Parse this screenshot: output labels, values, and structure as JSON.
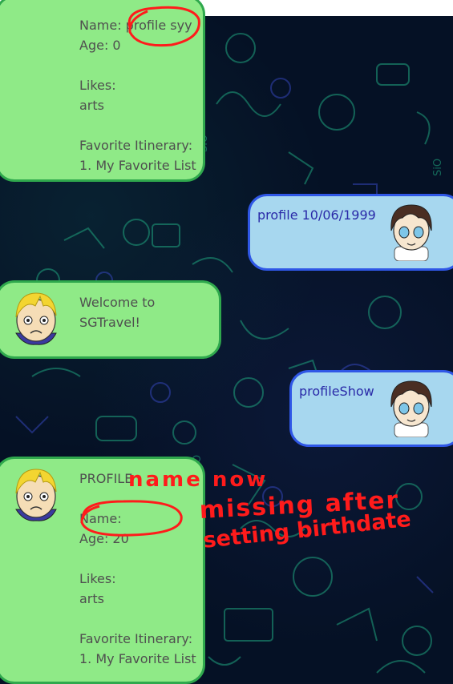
{
  "messages": [
    {
      "type": "bot",
      "name_line": "Name: profile syy",
      "age_line": "Age: 0",
      "likes_label": "Likes:",
      "likes_value": "arts",
      "fav_label": "Favorite Itinerary:",
      "fav_value": "1. My Favorite List"
    },
    {
      "type": "user",
      "text": "profile 10/06/1999"
    },
    {
      "type": "bot",
      "line1": "Welcome to",
      "line2": "SGTravel!"
    },
    {
      "type": "user",
      "text": "profileShow"
    },
    {
      "type": "bot",
      "header": "PROFILE",
      "name_line": "Name:",
      "age_line": "Age: 20",
      "likes_label": "Likes:",
      "likes_value": "arts",
      "fav_label": "Favorite Itinerary:",
      "fav_value": "1. My Favorite List"
    }
  ],
  "annotation": {
    "line1": "name now",
    "line2": "missing after",
    "line3": "setting birthdate"
  }
}
